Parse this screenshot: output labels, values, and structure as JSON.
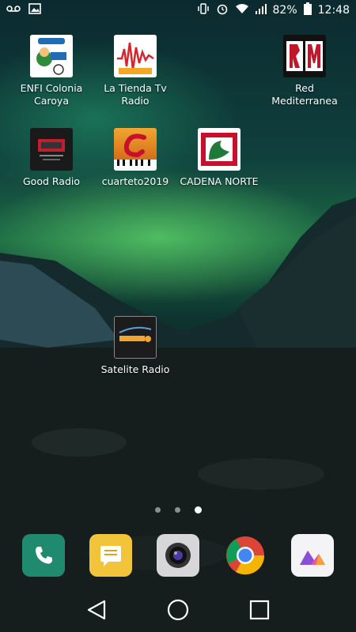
{
  "status_bar": {
    "battery_percent": "82%",
    "time": "12:48"
  },
  "apps": [
    {
      "label": "ENFI Colonia Caroya"
    },
    {
      "label": "La Tienda Tv Radio"
    },
    {
      "label": "Red Mediterranea"
    },
    {
      "label": "Good Radio"
    },
    {
      "label": "cuarteto2019"
    },
    {
      "label": "CADENA NORTE"
    },
    {
      "label": "Satelite Radio"
    }
  ],
  "page_indicator": {
    "total": 3,
    "active": 3
  },
  "dock": [
    "phone-app",
    "notes-app",
    "camera-app",
    "chrome-app",
    "gallery-app"
  ],
  "colors": {
    "phone": "#1f8a6e",
    "notes": "#f2c43b",
    "camera": "#d7d7da",
    "gallery": "#f4f4f6"
  }
}
